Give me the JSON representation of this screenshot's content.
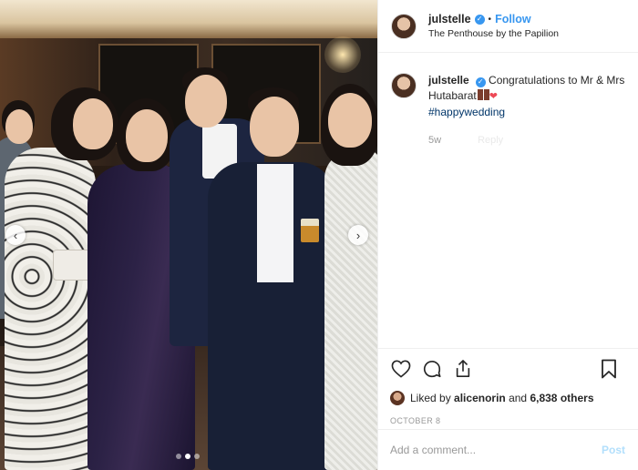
{
  "post": {
    "username": "julstelle",
    "follow_label": "Follow",
    "bullet": "•",
    "location": "The Penthouse by the Papilion"
  },
  "caption": {
    "username": "julstelle",
    "text": "Congratulations to Mr & Mrs Hutabarat",
    "hashtag": "#happywedding",
    "time": "5w",
    "reply_ghost": "Reply"
  },
  "engagement": {
    "liked_by_prefix": "Liked by",
    "liked_by_user": "alicenorin",
    "and_text": "and",
    "others_count": "6,838 others",
    "date": "OCTOBER 8"
  },
  "composer": {
    "placeholder": "Add a comment...",
    "post_label": "Post"
  },
  "carousel": {
    "slide_count": 3,
    "active_slide": 2
  },
  "icons": {
    "like": "heart-icon",
    "comment": "comment-icon",
    "share": "share-icon",
    "save": "bookmark-icon",
    "verified": "verified-badge-icon",
    "prev": "chevron-left-icon",
    "next": "chevron-right-icon"
  },
  "colors": {
    "accent": "#3897f0",
    "text": "#262626",
    "muted": "#999999",
    "post_disabled": "#b2dffc",
    "hashtag": "#003569",
    "heart_emoji": "#ed4956"
  }
}
